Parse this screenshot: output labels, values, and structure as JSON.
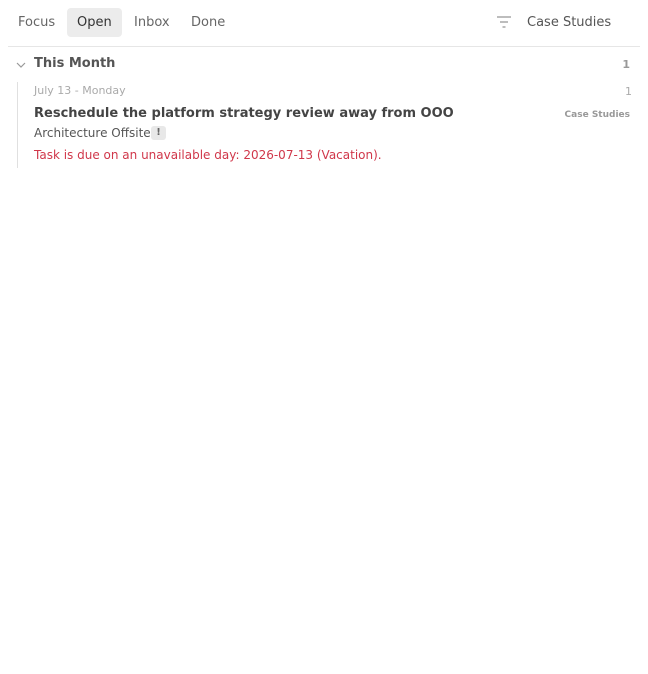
{
  "tabs": [
    {
      "label": "Focus",
      "active": false
    },
    {
      "label": "Open",
      "active": true
    },
    {
      "label": "Inbox",
      "active": false
    },
    {
      "label": "Done",
      "active": false
    }
  ],
  "toolbar": {
    "filter_icon": "filter-icon",
    "scope_label": "Case Studies"
  },
  "group": {
    "title": "This Month",
    "count": "1",
    "day": {
      "label": "July 13 - Monday",
      "count": "1",
      "task": {
        "title": "Reschedule the platform strategy review away from OOO",
        "tag": "Case Studies",
        "project": "Architecture Offsite",
        "priority_badge": "!",
        "warning": "Task is due on an unavailable day: 2026-07-13 (Vacation)."
      }
    }
  },
  "colors": {
    "warning": "#d0374a",
    "active_tab_bg": "#ececec"
  }
}
